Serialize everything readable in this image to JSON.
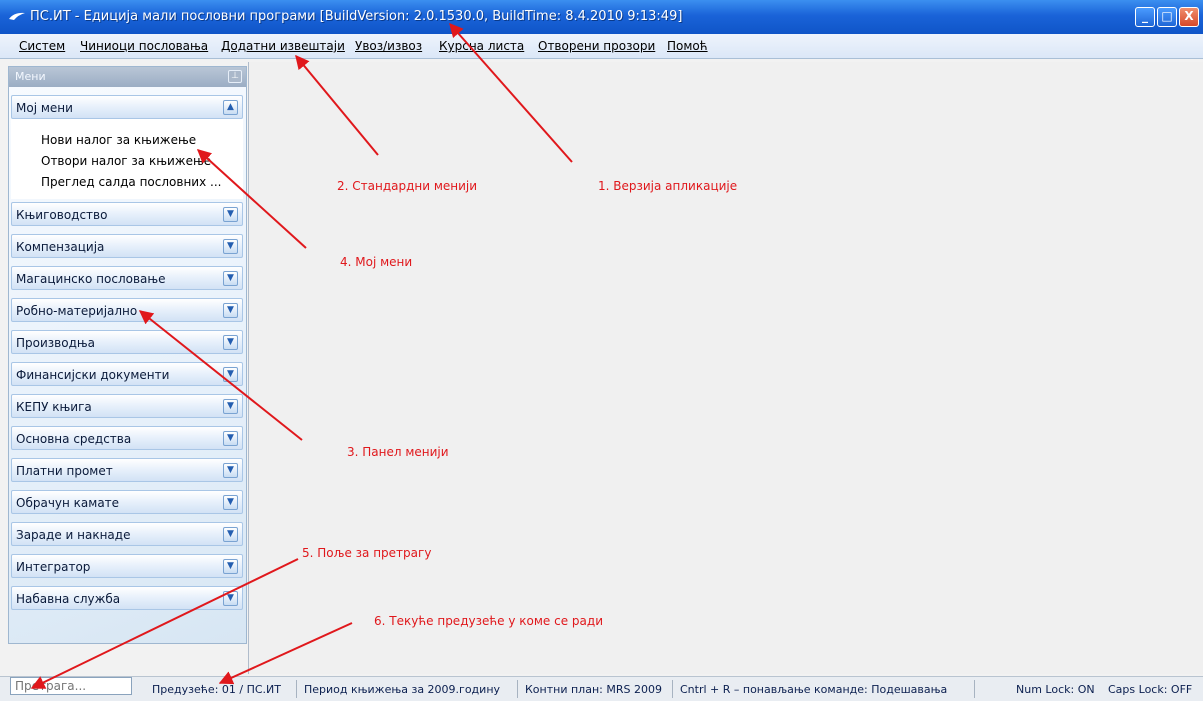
{
  "window": {
    "title": "ПС.ИТ - Едиција мали пословни програми [BuildVersion: 2.0.1530.0, BuildTime: 8.4.2010 9:13:49]",
    "controls": {
      "minimize": "_",
      "maximize": "□",
      "close": "X"
    }
  },
  "menu": {
    "items": [
      "Систем",
      "Чиниоци пословања",
      "Додатни извештаји",
      "Увоз/извоз",
      "Курсна листа",
      "Отворени прозори",
      "Помоћ"
    ]
  },
  "left_panel": {
    "header": "Мени",
    "my_menu": {
      "title": "Мој мени",
      "items": [
        "Нови налог за књижење",
        "Отвори налог за књижење",
        "Преглед салда пословних ..."
      ]
    },
    "sections": [
      "Књиговодство",
      "Компензација",
      "Магацинско пословање",
      "Робно-материјално",
      "Производња",
      "Финансијски документи",
      "КЕПУ књига",
      "Основна средства",
      "Платни промет",
      "Обрачун камате",
      "Зараде и накнаде",
      "Интегратор",
      "Набавна служба"
    ]
  },
  "status": {
    "search_placeholder": "Претрага...",
    "company": "Предузеће: 01 / ПС.ИТ",
    "period": "Период књижења за 2009.годину",
    "chart_of_accounts": "Контни план: MRS 2009",
    "repeat_command": "Cntrl + R – понављање команде: Подешавања",
    "num_lock": "Num Lock: ON",
    "caps_lock": "Caps Lock: OFF"
  },
  "annotations": {
    "a1": "1. Верзија апликације",
    "a2": "2. Стандардни менији",
    "a3": "3. Панел менији",
    "a4": "4. Мој мени",
    "a5": "5. Поље за претрагу",
    "a6": "6. Текуће предузеће у коме се ради"
  },
  "colors": {
    "annotation": "#e0181c",
    "titlebar": "#1a63d8"
  }
}
